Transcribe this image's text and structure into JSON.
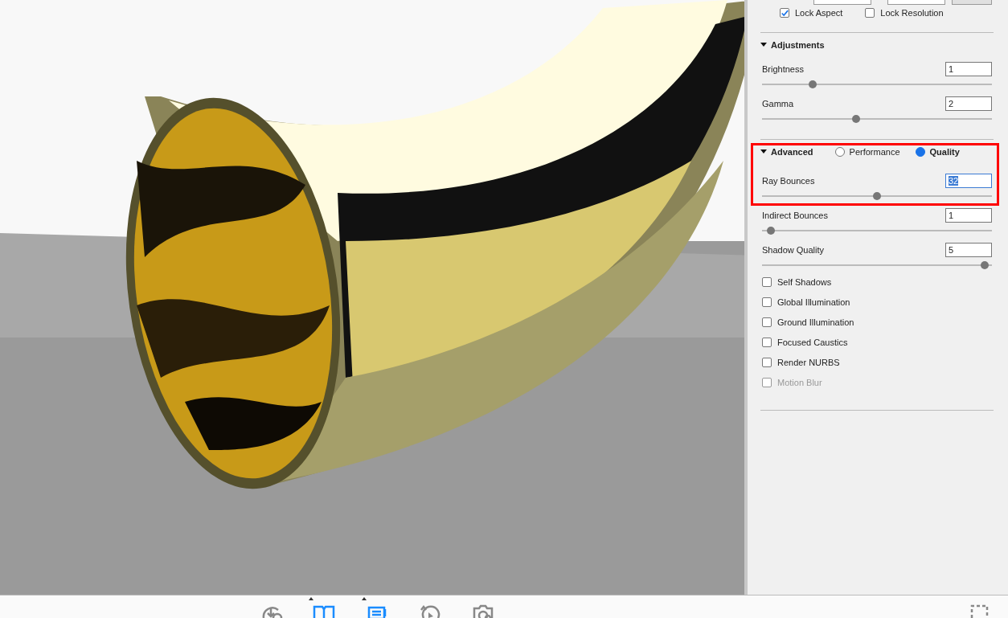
{
  "render_settings": {
    "lock_options": [
      {
        "label": "Lock Aspect",
        "checked": true
      },
      {
        "label": "Lock Resolution",
        "checked": false
      }
    ],
    "adjustments": {
      "title": "Adjustments",
      "expanded": true,
      "sliders": [
        {
          "label": "Brightness",
          "value": "1",
          "level": 0.22,
          "focused": false
        },
        {
          "label": "Gamma",
          "value": "2",
          "level": 0.41,
          "focused": false
        }
      ]
    },
    "advanced": {
      "title": "Advanced",
      "expanded": true,
      "modes": [
        {
          "label": "Performance",
          "selected": false
        },
        {
          "label": "Quality",
          "selected": true
        }
      ],
      "sliders": [
        {
          "label": "Ray Bounces",
          "value": "32",
          "level": 0.5,
          "focused": true
        },
        {
          "label": "Indirect Bounces",
          "value": "1",
          "level": 0.04,
          "focused": false
        },
        {
          "label": "Shadow Quality",
          "value": "5",
          "level": 0.97,
          "focused": false
        }
      ],
      "options": [
        {
          "label": "Self Shadows",
          "checked": false,
          "disabled": false
        },
        {
          "label": "Global Illumination",
          "checked": false,
          "disabled": false
        },
        {
          "label": "Ground Illumination",
          "checked": false,
          "disabled": false
        },
        {
          "label": "Focused Caustics",
          "checked": false,
          "disabled": false
        },
        {
          "label": "Render NURBS",
          "checked": false,
          "disabled": false
        },
        {
          "label": "Motion Blur",
          "checked": false,
          "disabled": true
        }
      ]
    }
  },
  "toolbar": [
    {
      "kind": "download",
      "active": false,
      "menu": false
    },
    {
      "kind": "book",
      "active": true,
      "menu": true
    },
    {
      "kind": "list",
      "active": true,
      "menu": true
    },
    {
      "kind": "replay",
      "active": false,
      "menu": false
    },
    {
      "kind": "camera",
      "active": false,
      "menu": false
    }
  ]
}
